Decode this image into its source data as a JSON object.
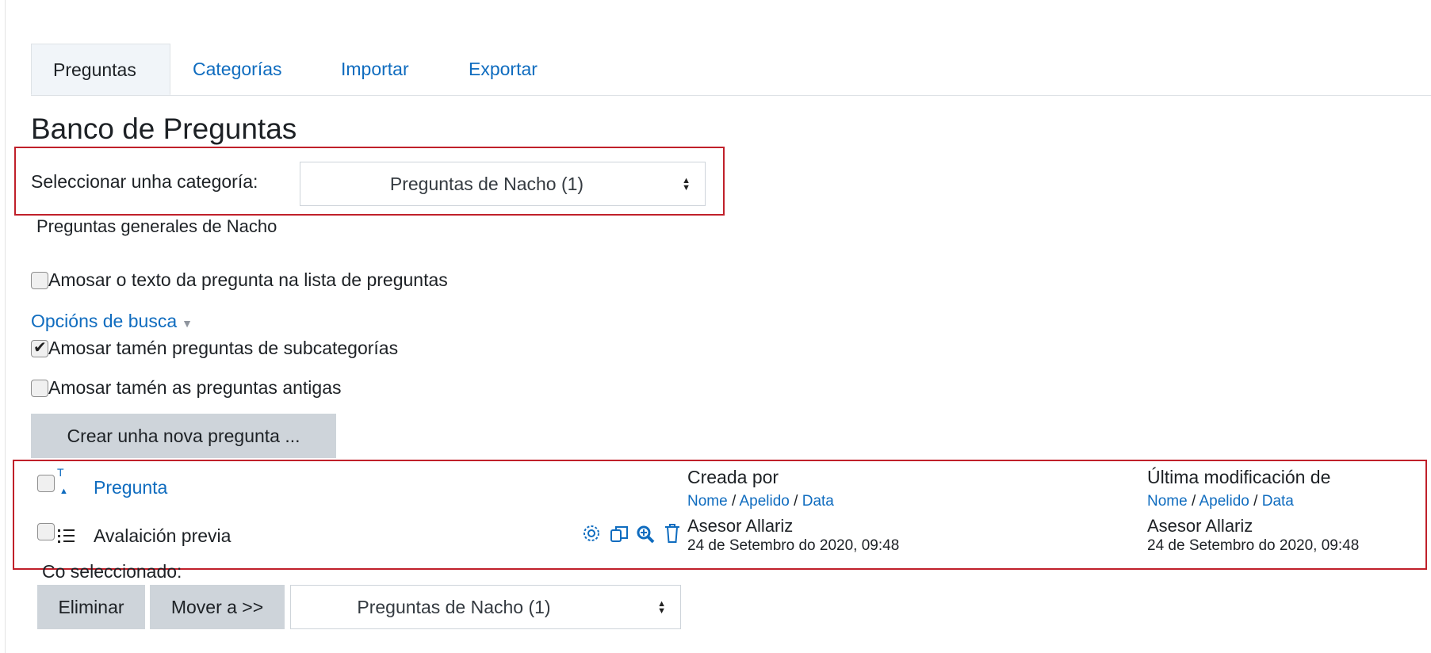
{
  "tabs": [
    "Preguntas",
    "Categorías",
    "Importar",
    "Exportar"
  ],
  "page_title": "Banco de Preguntas",
  "category_select": {
    "label": "Seleccionar unha categoría:",
    "value": "Preguntas de Nacho (1)"
  },
  "category_info": "Preguntas generales de Nacho",
  "show_question_text": {
    "label": "Amosar o texto da pregunta na lista de preguntas",
    "checked": false
  },
  "search_options": {
    "label": "Opcións de busca",
    "subcategories": {
      "label": "Amosar tamén preguntas de subcategorías",
      "checked": true
    },
    "old_questions": {
      "label": "Amosar tamén as preguntas antigas",
      "checked": false
    }
  },
  "create_button": "Crear unha nova pregunta ...",
  "table": {
    "col_question": "Pregunta",
    "col_created": "Creada por",
    "col_modified": "Última modificación de",
    "sort_nome": "Nome",
    "sort_apelido": "Apelido",
    "sort_data": "Data",
    "separator": "/",
    "rows": [
      {
        "name": "Avalaición previa",
        "created_by": "Asesor Allariz",
        "created_date": "24 de Setembro do 2020, 09:48",
        "modified_by": "Asesor Allariz",
        "modified_date": "24 de Setembro do 2020, 09:48"
      }
    ]
  },
  "with_selected": {
    "label": "Co seleccionado:",
    "delete_button": "Eliminar",
    "move_button": "Mover a >>",
    "move_select_value": "Preguntas de Nacho (1)"
  },
  "colors": {
    "link": "#0f6cbf",
    "highlight": "#c0202a",
    "button_bg": "#ced4da"
  }
}
